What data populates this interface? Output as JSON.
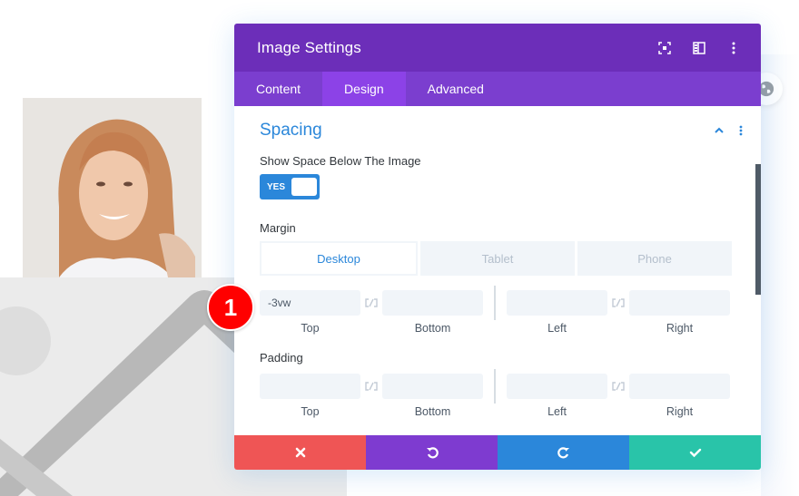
{
  "background": {
    "photo_alt": "Smiling woman with curly red hair",
    "placeholder_alt": "Image placeholder"
  },
  "modal": {
    "title": "Image Settings",
    "header_icons": [
      "expand-icon",
      "split-view-icon",
      "more-icon"
    ],
    "tabs": [
      {
        "label": "Content",
        "active": false
      },
      {
        "label": "Design",
        "active": true
      },
      {
        "label": "Advanced",
        "active": false
      }
    ],
    "section": {
      "title": "Spacing",
      "icons": [
        "chevron-up-icon",
        "more-icon"
      ]
    },
    "show_space": {
      "label": "Show Space Below The Image",
      "toggle_label": "YES",
      "value": true
    },
    "margin": {
      "label": "Margin",
      "device_tabs": [
        {
          "label": "Desktop",
          "active": true
        },
        {
          "label": "Tablet",
          "active": false
        },
        {
          "label": "Phone",
          "active": false
        }
      ],
      "fields": [
        {
          "label": "Top",
          "value": "-3vw"
        },
        {
          "label": "Bottom",
          "value": ""
        },
        {
          "label": "Left",
          "value": ""
        },
        {
          "label": "Right",
          "value": ""
        }
      ]
    },
    "padding": {
      "label": "Padding",
      "fields": [
        {
          "label": "Top",
          "value": ""
        },
        {
          "label": "Bottom",
          "value": ""
        },
        {
          "label": "Left",
          "value": ""
        },
        {
          "label": "Right",
          "value": ""
        }
      ]
    },
    "footer": [
      {
        "name": "cancel",
        "icon": "close-icon",
        "color": "#ef5555"
      },
      {
        "name": "undo",
        "icon": "undo-icon",
        "color": "#7e3bd0"
      },
      {
        "name": "redo",
        "icon": "redo-icon",
        "color": "#2b87da"
      },
      {
        "name": "save",
        "icon": "check-icon",
        "color": "#29c4a9"
      }
    ]
  },
  "annotation": {
    "badge_number": "1"
  },
  "colors": {
    "header": "#6c2eb9",
    "tabs": "#7b3ecf",
    "active_tab": "#8c42e7",
    "accent": "#2b87da",
    "badge": "#ff0000"
  }
}
